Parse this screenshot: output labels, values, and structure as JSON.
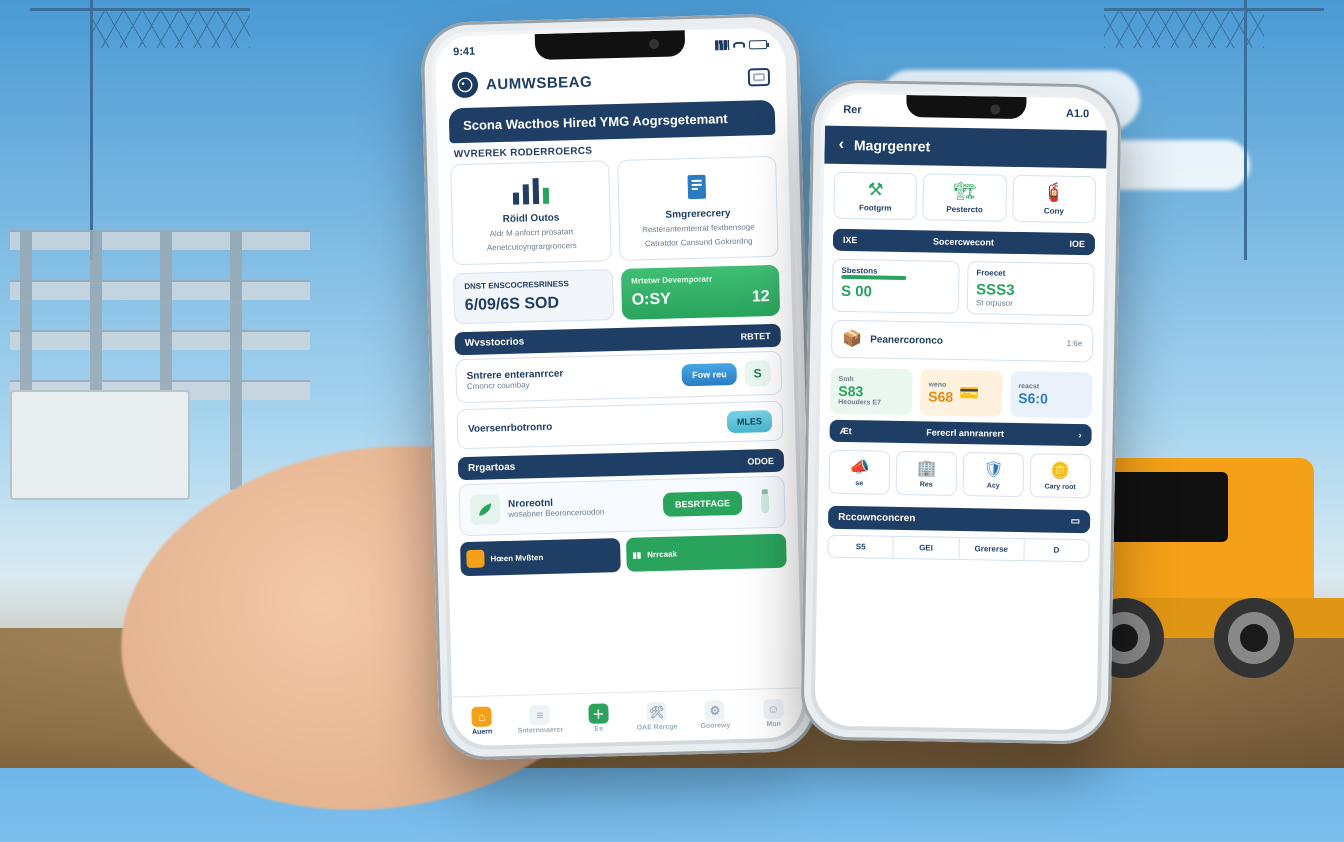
{
  "scene": {
    "note": "Two smartphones showing a construction management app, held in hand at a job site with cranes, steel frame, container, and an orange truck."
  },
  "phoneA": {
    "status": {
      "time": "9:41"
    },
    "brand": "AUMWSBEAG",
    "title": "Scona Wacthos Hired YMG Aogrsgetemant",
    "sub": "WVREREK RODERROERCS",
    "cards": [
      {
        "icon": "chart-bar-icon",
        "title": "Röidl Outos",
        "line1": "Aldr M anfocrt prosatart",
        "line2": "Aenetcutoyngrargroncers"
      },
      {
        "icon": "document-icon",
        "title": "Smgrerecrery",
        "line1": "Resteranterntenrat fextbensoge",
        "line2": "Catratdor Cansund Gokrordng"
      }
    ],
    "kpis": [
      {
        "label": "DNST ENSCOCRESRINESS",
        "value": "6/09/6S SOD"
      },
      {
        "label": "Mrtetwr Devemporarr",
        "valueA": "O:SY",
        "valueB": "12"
      }
    ],
    "sectionA": {
      "title": "Wvsstocrios",
      "link": "RBTET"
    },
    "listA": [
      {
        "title": "Sntrere enteranrrcer",
        "sub": "Cmoncr coumbay",
        "pill": "Fow reu",
        "badge": "S"
      },
      {
        "title": "Voersenrbotronro",
        "sub": "",
        "pill": "MLES",
        "badge": ""
      }
    ],
    "sectionB": {
      "title": "Rrgartoas",
      "link": "ODOE"
    },
    "banner": {
      "title": "Nroreotnl",
      "sub": "wosabner Beoronceroodon",
      "button": "BESRTFAGE"
    },
    "strip": [
      {
        "type": "dark",
        "text": "Hœen Mvßten"
      },
      {
        "type": "green",
        "text": "Nrrcaak"
      }
    ],
    "tabs": [
      {
        "label": "Auern",
        "icon": "home-icon",
        "style": "o",
        "active": true
      },
      {
        "label": "Snternmaercr",
        "icon": "list-icon",
        "style": "",
        "active": false
      },
      {
        "label": "Es",
        "icon": "plus-icon",
        "style": "g",
        "active": false
      },
      {
        "label": "OAE Rercge",
        "icon": "wrench-icon",
        "style": "",
        "active": false
      },
      {
        "label": "Goorewy",
        "icon": "gear-icon",
        "style": "",
        "active": false
      },
      {
        "label": "Mon",
        "icon": "user-icon",
        "style": "",
        "active": false
      }
    ]
  },
  "phoneB": {
    "status": {
      "left": "Rer",
      "right": "A1.0"
    },
    "back": "‹",
    "title": "Magrgenret",
    "seg": [
      {
        "icon": "machine-icon",
        "label": "Footgrm"
      },
      {
        "icon": "crane-icon",
        "label": "Pestercto"
      },
      {
        "icon": "pipe-icon",
        "label": "Cony"
      }
    ],
    "bar": {
      "left": "IXE",
      "center": "Socercwecont",
      "right": "IOE"
    },
    "kpis": [
      {
        "label": "Sbestons",
        "value": "S 00",
        "bar": true
      },
      {
        "label": "Froecet",
        "value": "SSS3",
        "sub": "St orpusor"
      }
    ],
    "barlite": {
      "icon": "box-icon",
      "text": "Peanercoronco",
      "time": "1:6e"
    },
    "pills": [
      {
        "cls": "g",
        "top": "Smh",
        "val": "S83",
        "sub": "Heouders E7"
      },
      {
        "cls": "o",
        "top": "weno",
        "val": "S68",
        "sub": ""
      },
      {
        "cls": "b",
        "top": "reacst",
        "val": "S6:0",
        "sub": ""
      }
    ],
    "bar2": {
      "left": "Æt",
      "text": "Ferecrl annranrert"
    },
    "grid": [
      {
        "icon": "megaphone-icon",
        "label": "se"
      },
      {
        "icon": "building-icon",
        "label": "Res"
      },
      {
        "icon": "shield-icon",
        "label": "Acy"
      },
      {
        "icon": "coin-icon",
        "label": "Cary root"
      }
    ],
    "sectionC": "Rccownconcren",
    "segbar": [
      "S5",
      "GEI",
      "Grererse",
      "D"
    ]
  }
}
